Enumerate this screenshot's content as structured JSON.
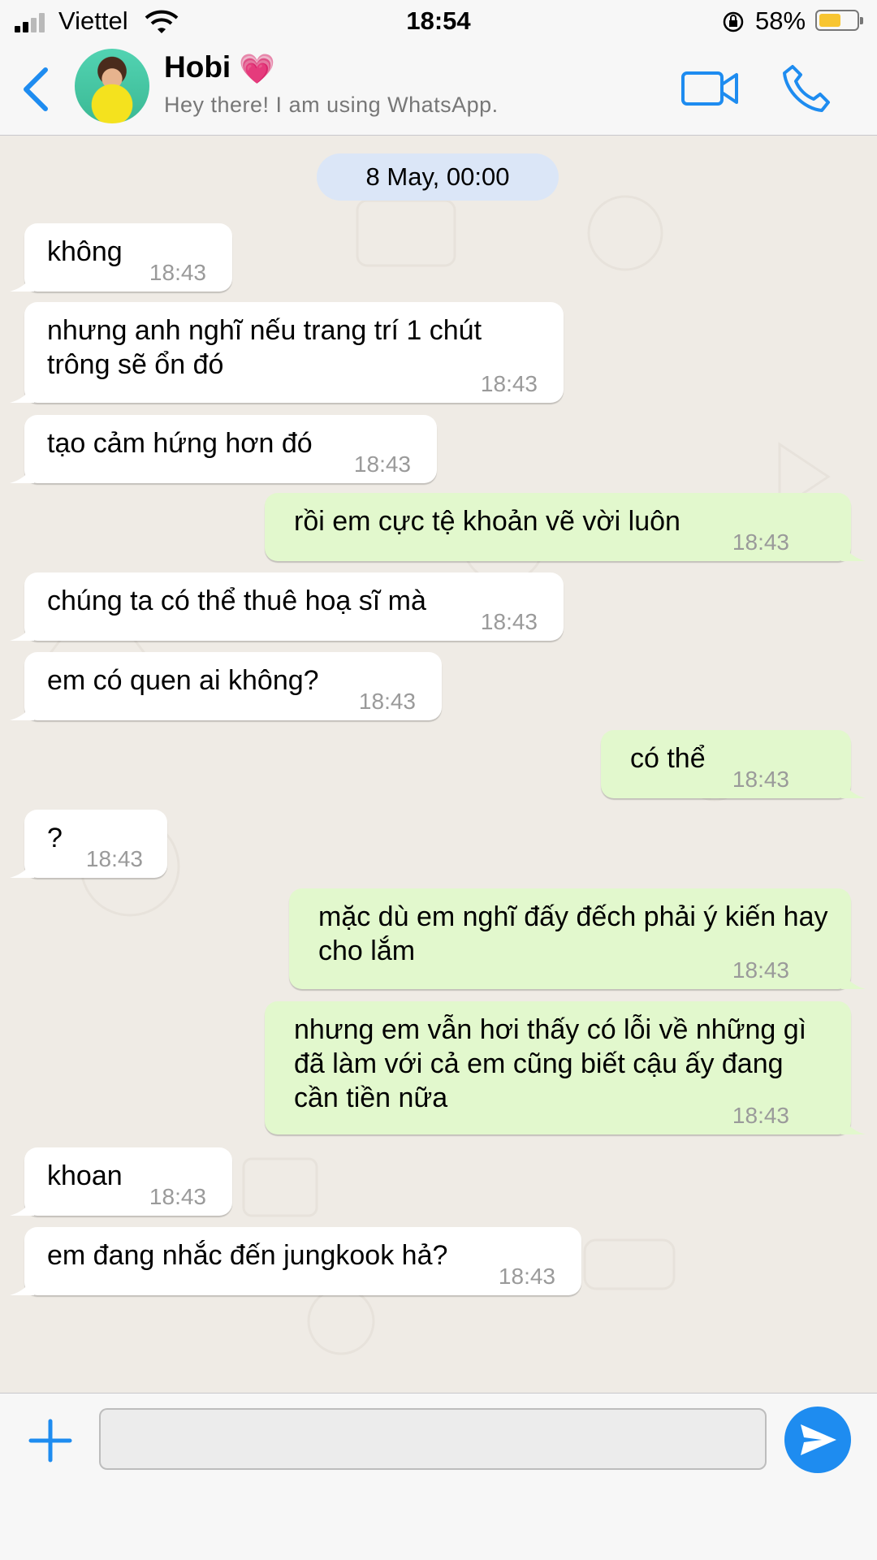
{
  "status_bar": {
    "carrier": "Viettel",
    "time": "18:54",
    "battery_percent": "58%",
    "battery_level": 0.58,
    "signal_bars": 2
  },
  "header": {
    "contact_name": "Hobi",
    "contact_emoji": "💗",
    "contact_status": "Hey there! I am using WhatsApp."
  },
  "chat": {
    "date_label": "8 May, 00:00",
    "messages": [
      {
        "direction": "in",
        "text": "không",
        "time": "18:43"
      },
      {
        "direction": "in",
        "text": "nhưng anh nghĩ nếu trang trí 1 chút trông sẽ ổn đó",
        "time": "18:43"
      },
      {
        "direction": "in",
        "text": "tạo cảm hứng hơn đó",
        "time": "18:43"
      },
      {
        "direction": "out",
        "text": "rồi em cực tệ khoản vẽ vời luôn",
        "time": "18:43"
      },
      {
        "direction": "in",
        "text": "chúng ta có thể thuê hoạ sĩ mà",
        "time": "18:43"
      },
      {
        "direction": "in",
        "text": "em có quen ai không?",
        "time": "18:43"
      },
      {
        "direction": "out",
        "text": "có thể",
        "time": "18:43"
      },
      {
        "direction": "in",
        "text": "?",
        "time": "18:43"
      },
      {
        "direction": "out",
        "text": "mặc dù em nghĩ đấy đếch phải ý kiến hay cho lắm",
        "time": "18:43"
      },
      {
        "direction": "out",
        "text": "nhưng em vẫn hơi thấy có lỗi về những gì đã làm với cả em cũng biết cậu ấy đang cần tiền nữa",
        "time": "18:43"
      },
      {
        "direction": "in",
        "text": "khoan",
        "time": "18:43"
      },
      {
        "direction": "in",
        "text": "em đang nhắc đến jungkook hả?",
        "time": "18:43"
      }
    ]
  },
  "input": {
    "value": "",
    "placeholder": ""
  },
  "colors": {
    "accent": "#1e8cf0",
    "incoming_bubble": "#ffffff",
    "outgoing_bubble": "#e2f8cd",
    "date_chip": "#dbe6f7",
    "chat_background": "#efebe5"
  },
  "icons": [
    "back-chevron-icon",
    "video-camera-icon",
    "phone-icon",
    "plus-icon",
    "send-icon",
    "wifi-icon",
    "rotation-lock-icon",
    "battery-icon"
  ]
}
